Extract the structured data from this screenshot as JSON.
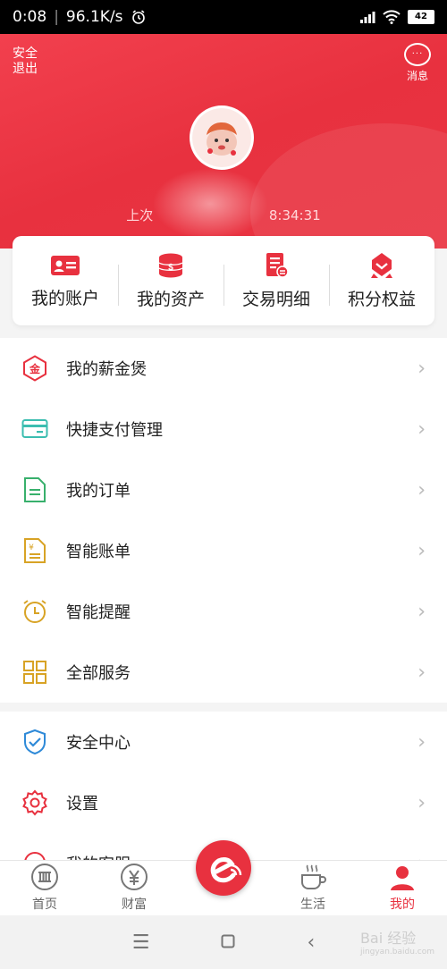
{
  "status_bar": {
    "time": "0:08",
    "speed": "96.1K/s",
    "battery": "42"
  },
  "header": {
    "logout_label": "安全退出",
    "messages_label": "消息",
    "login_time_prefix": "上次",
    "login_time": "8:34:31"
  },
  "quick_menu": [
    {
      "label": "我的账户",
      "icon": "id-card-icon"
    },
    {
      "label": "我的资产",
      "icon": "coins-icon"
    },
    {
      "label": "交易明细",
      "icon": "receipt-icon"
    },
    {
      "label": "积分权益",
      "icon": "badge-icon"
    }
  ],
  "menu_group_1": [
    {
      "label": "我的薪金煲",
      "icon": "gold-hexagon-icon",
      "icon_text": "金"
    },
    {
      "label": "快捷支付管理",
      "icon": "card-icon"
    },
    {
      "label": "我的订单",
      "icon": "document-icon"
    },
    {
      "label": "智能账单",
      "icon": "bill-icon"
    },
    {
      "label": "智能提醒",
      "icon": "alarm-clock-icon"
    },
    {
      "label": "全部服务",
      "icon": "grid-icon"
    }
  ],
  "menu_group_2": [
    {
      "label": "安全中心",
      "icon": "shield-check-icon"
    },
    {
      "label": "设置",
      "icon": "gear-icon"
    },
    {
      "label": "我的客服",
      "icon": "headset-icon"
    }
  ],
  "tabs": [
    {
      "label": "首页",
      "icon": "bank-icon"
    },
    {
      "label": "财富",
      "icon": "yen-icon"
    },
    {
      "label": "生活",
      "icon": "coffee-icon"
    },
    {
      "label": "我的",
      "icon": "person-icon"
    }
  ],
  "watermark": "Bai 经验",
  "watermark_sub": "jingyan.baidu.com",
  "colors": {
    "brand_red": "#e8313f",
    "accent_gold": "#d8a325",
    "accent_blue": "#2f8ad8",
    "accent_green": "#38b06c",
    "accent_teal": "#3bbdb0"
  }
}
